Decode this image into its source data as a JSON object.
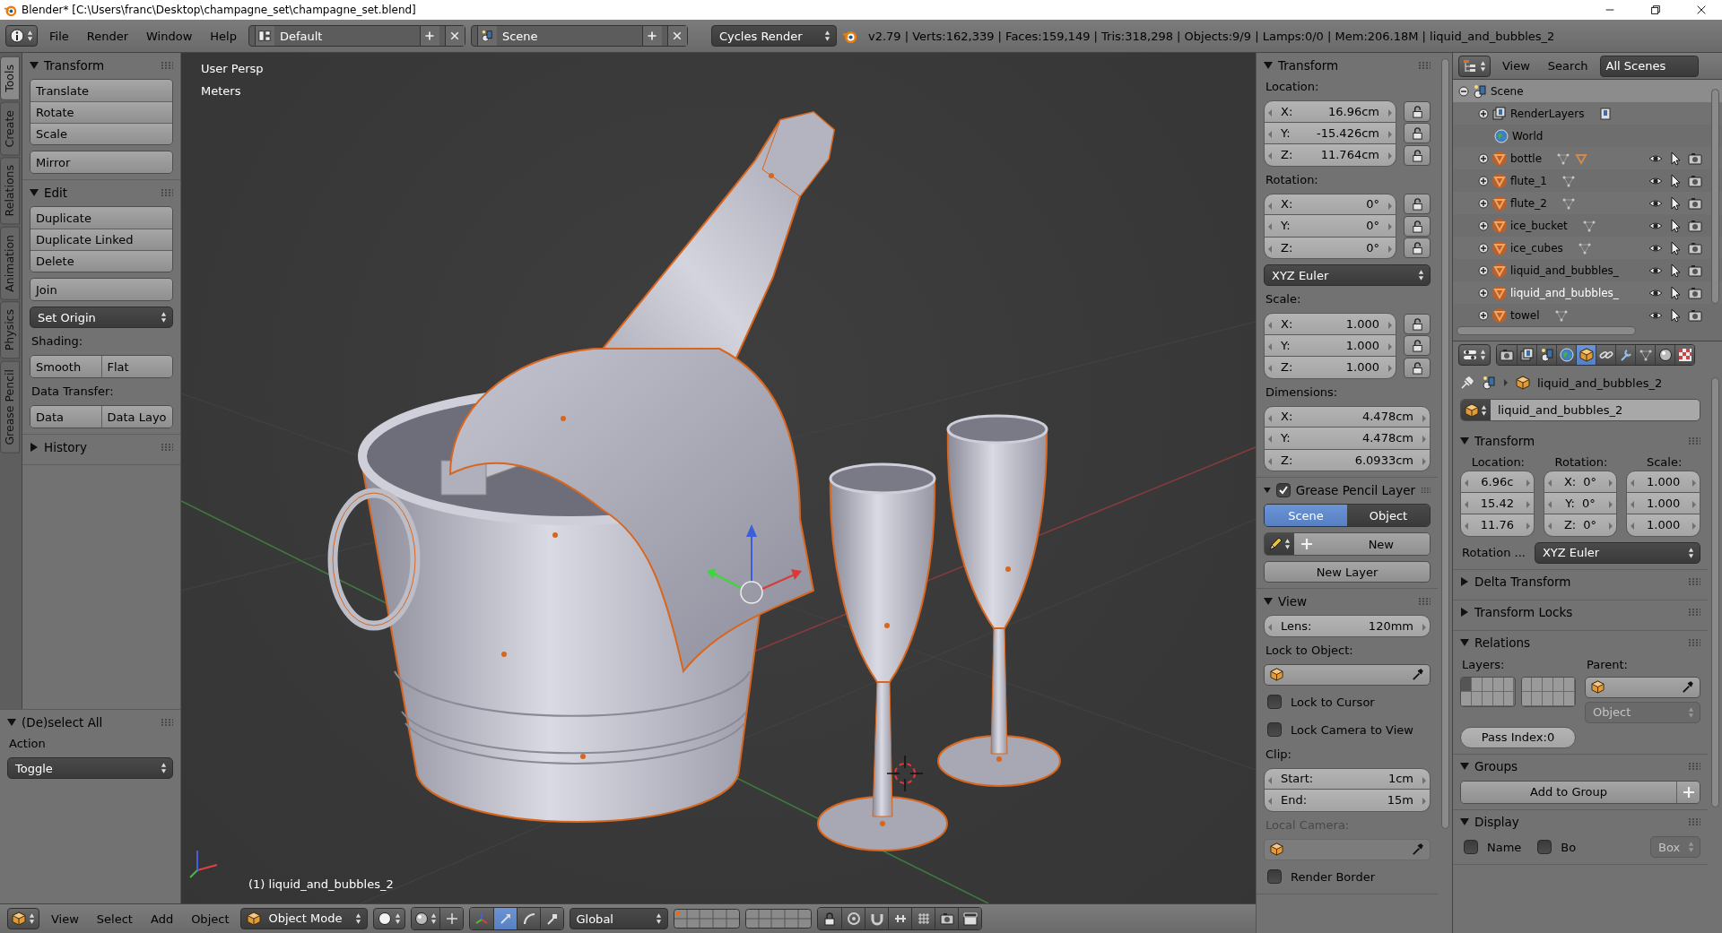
{
  "title_bar": {
    "title": "Blender* [C:\\Users\\franc\\Desktop\\champagne_set\\champagne_set.blend]"
  },
  "info_header": {
    "menus": [
      "File",
      "Render",
      "Window",
      "Help"
    ],
    "layout": "Default",
    "scene": "Scene",
    "engine": "Cycles Render",
    "stats": "v2.79 | Verts:162,339 | Faces:159,149 | Tris:318,298 | Objects:9/9 | Lamps:0/0 | Mem:206.18M | liquid_and_bubbles_2"
  },
  "tool_tabs": [
    {
      "label": "Tools",
      "selected": true
    },
    {
      "label": "Create",
      "selected": false
    },
    {
      "label": "Relations",
      "selected": false
    },
    {
      "label": "Animation",
      "selected": false
    },
    {
      "label": "Physics",
      "selected": false
    },
    {
      "label": "Grease Pencil",
      "selected": false
    }
  ],
  "tool_shelf": [
    {
      "title": "Transform",
      "expanded": true,
      "items": [
        {
          "kind": "stack",
          "buttons": [
            "Translate",
            "Rotate",
            "Scale"
          ]
        },
        {
          "kind": "stack",
          "buttons": [
            "Mirror"
          ]
        }
      ]
    },
    {
      "title": "Edit",
      "expanded": true,
      "items": [
        {
          "kind": "stack",
          "buttons": [
            "Duplicate",
            "Duplicate Linked",
            "Delete"
          ]
        },
        {
          "kind": "stack",
          "buttons": [
            "Join"
          ]
        },
        {
          "kind": "dropdown",
          "value": "Set Origin"
        },
        {
          "kind": "label",
          "text": "Shading:"
        },
        {
          "kind": "row",
          "buttons": [
            "Smooth",
            "Flat"
          ]
        },
        {
          "kind": "label",
          "text": "Data Transfer:"
        },
        {
          "kind": "row",
          "buttons": [
            "Data",
            "Data Layo"
          ]
        }
      ]
    },
    {
      "title": "History",
      "expanded": false
    }
  ],
  "operator_panel": {
    "title": "(De)select All",
    "expanded": true,
    "items": [
      {
        "kind": "label",
        "text": "Action"
      },
      {
        "kind": "dropdown",
        "value": "Toggle"
      }
    ]
  },
  "viewport": {
    "view": "User Persp",
    "units": "Meters",
    "object": "(1) liquid_and_bubbles_2"
  },
  "n_panel": [
    {
      "title": "Transform",
      "expanded": true,
      "items": [
        {
          "kind": "label",
          "text": "Location:"
        },
        {
          "kind": "fields",
          "fields": [
            {
              "label": "X:",
              "value": "16.96cm",
              "locked": false
            },
            {
              "label": "Y:",
              "value": "-15.426cm",
              "locked": false
            },
            {
              "label": "Z:",
              "value": "11.764cm",
              "locked": false
            }
          ]
        },
        {
          "kind": "label",
          "text": "Rotation:"
        },
        {
          "kind": "fields",
          "fields": [
            {
              "label": "X:",
              "value": "0°",
              "locked": false
            },
            {
              "label": "Y:",
              "value": "0°",
              "locked": false
            },
            {
              "label": "Z:",
              "value": "0°",
              "locked": false
            }
          ]
        },
        {
          "kind": "dropdown",
          "value": "XYZ Euler"
        },
        {
          "kind": "label",
          "text": "Scale:"
        },
        {
          "kind": "fields",
          "fields": [
            {
              "label": "X:",
              "value": "1.000",
              "locked": false
            },
            {
              "label": "Y:",
              "value": "1.000",
              "locked": false
            },
            {
              "label": "Z:",
              "value": "1.000",
              "locked": false
            }
          ]
        },
        {
          "kind": "label",
          "text": "Dimensions:"
        },
        {
          "kind": "fields",
          "fields": [
            {
              "label": "X:",
              "value": "4.478cm"
            },
            {
              "label": "Y:",
              "value": "4.478cm"
            },
            {
              "label": "Z:",
              "value": "6.0933cm"
            }
          ]
        }
      ]
    },
    {
      "title": "Grease Pencil Layer",
      "expanded": true,
      "checked": true,
      "items": [
        {
          "kind": "tabs",
          "tabs": [
            {
              "label": "Scene",
              "selected": true
            },
            {
              "label": "Object",
              "selected": false
            }
          ]
        },
        {
          "kind": "new_row",
          "text": "New"
        },
        {
          "kind": "button",
          "text": "New Layer"
        }
      ]
    },
    {
      "title": "View",
      "expanded": true,
      "items": [
        {
          "kind": "fields",
          "fields": [
            {
              "label": "Lens:",
              "value": "120mm"
            }
          ]
        },
        {
          "kind": "label",
          "text": "Lock to Object:"
        },
        {
          "kind": "object_field",
          "disabled": false
        },
        {
          "kind": "checkbox",
          "text": "Lock to Cursor",
          "checked": false
        },
        {
          "kind": "checkbox",
          "text": "Lock Camera to View",
          "checked": false
        },
        {
          "kind": "label",
          "text": "Clip:"
        },
        {
          "kind": "fields",
          "fields": [
            {
              "label": "Start:",
              "value": "1cm"
            },
            {
              "label": "End:",
              "value": "15m"
            }
          ]
        },
        {
          "kind": "label",
          "text": "Local Camera:",
          "disabled": true
        },
        {
          "kind": "object_field",
          "disabled": true
        },
        {
          "kind": "checkbox",
          "text": "Render Border",
          "checked": false
        }
      ]
    }
  ],
  "outliner": {
    "menus": [
      "View",
      "Search"
    ],
    "filter": "All Scenes",
    "tree": [
      {
        "name": "Scene",
        "kind": "scene",
        "expanded": true,
        "selected": true,
        "active": false,
        "children": [
          {
            "name": "RenderLayers",
            "kind": "renderlayers",
            "expanded": false,
            "selected": false,
            "active": false,
            "shows_data": true
          },
          {
            "name": "World",
            "kind": "world",
            "selected": false,
            "active": false
          },
          {
            "name": "bottle",
            "kind": "mesh",
            "expanded": false,
            "selected": false,
            "active": false,
            "shows_data": true,
            "shows_material": true
          },
          {
            "name": "flute_1",
            "kind": "mesh",
            "expanded": false,
            "selected": false,
            "active": false,
            "shows_data": true
          },
          {
            "name": "flute_2",
            "kind": "mesh",
            "expanded": false,
            "selected": false,
            "active": false,
            "shows_data": true
          },
          {
            "name": "ice_bucket",
            "kind": "mesh",
            "expanded": false,
            "selected": false,
            "active": false,
            "shows_data": true
          },
          {
            "name": "ice_cubes",
            "kind": "mesh",
            "expanded": false,
            "selected": false,
            "active": false,
            "shows_data": true
          },
          {
            "name": "liquid_and_bubbles_",
            "kind": "mesh",
            "expanded": false,
            "selected": false,
            "active": false
          },
          {
            "name": "liquid_and_bubbles_",
            "kind": "mesh",
            "expanded": false,
            "selected": false,
            "active": true
          },
          {
            "name": "towel",
            "kind": "mesh",
            "expanded": false,
            "selected": false,
            "active": false,
            "shows_data": true
          }
        ]
      }
    ]
  },
  "properties": {
    "tabs": [
      {
        "kind": "render",
        "selected": false
      },
      {
        "kind": "render_layers",
        "selected": false
      },
      {
        "kind": "scene",
        "selected": false
      },
      {
        "kind": "world",
        "selected": false
      },
      {
        "kind": "object",
        "selected": true
      },
      {
        "kind": "constraints",
        "selected": false
      },
      {
        "kind": "modifiers",
        "selected": false
      },
      {
        "kind": "data",
        "selected": false
      },
      {
        "kind": "material",
        "selected": false
      },
      {
        "kind": "texture",
        "selected": false
      }
    ],
    "path": "liquid_and_bubbles_2",
    "name": "liquid_and_bubbles_2",
    "panels": [
      {
        "title": "Transform",
        "expanded": true,
        "items": [
          {
            "kind": "columns",
            "columns": [
              {
                "title": "Location:",
                "fields": [
                  {
                    "value": "6.96c"
                  },
                  {
                    "value": "15.42"
                  },
                  {
                    "value": "11.76"
                  }
                ]
              },
              {
                "title": "Rotation:",
                "fields": [
                  {
                    "label": "X:",
                    "value": "0°"
                  },
                  {
                    "label": "Y:",
                    "value": "0°"
                  },
                  {
                    "label": "Z:",
                    "value": "0°"
                  }
                ]
              },
              {
                "title": "Scale:",
                "fields": [
                  {
                    "value": "1.000"
                  },
                  {
                    "value": "1.000"
                  },
                  {
                    "value": "1.000"
                  }
                ]
              }
            ]
          },
          {
            "kind": "labeled_dropdown",
            "label": "Rotation ...",
            "value": "XYZ Euler"
          }
        ]
      },
      {
        "title": "Delta Transform",
        "expanded": false
      },
      {
        "title": "Transform Locks",
        "expanded": false
      },
      {
        "title": "Relations",
        "expanded": true,
        "items": [
          {
            "kind": "relations",
            "layers_label": "Layers:",
            "layers": [
              true,
              false,
              false,
              false,
              false,
              false,
              false,
              false,
              false,
              false,
              false,
              false,
              false,
              false,
              false,
              false,
              false,
              false,
              false,
              false
            ],
            "parent_label": "Parent:",
            "parent_type": "Object",
            "pass_index": "Pass Index:0"
          }
        ]
      },
      {
        "title": "Groups",
        "expanded": true,
        "items": [
          {
            "kind": "add_button",
            "text": "Add to Group"
          }
        ]
      },
      {
        "title": "Display",
        "expanded": true,
        "items": [
          {
            "kind": "display_row",
            "checks": [
              {
                "text": "Name",
                "checked": false
              },
              {
                "text": "Bo",
                "checked": false
              }
            ],
            "dropdown": "Box"
          }
        ]
      }
    ]
  },
  "viewport_header": {
    "menus": [
      "View",
      "Select",
      "Add",
      "Object"
    ],
    "mode": "Object Mode",
    "manipulators": [
      {
        "kind": "axes",
        "selected": false
      },
      {
        "kind": "translate",
        "selected": true
      },
      {
        "kind": "rotate",
        "selected": false
      },
      {
        "kind": "scale",
        "selected": false
      }
    ],
    "orientation": "Global"
  }
}
